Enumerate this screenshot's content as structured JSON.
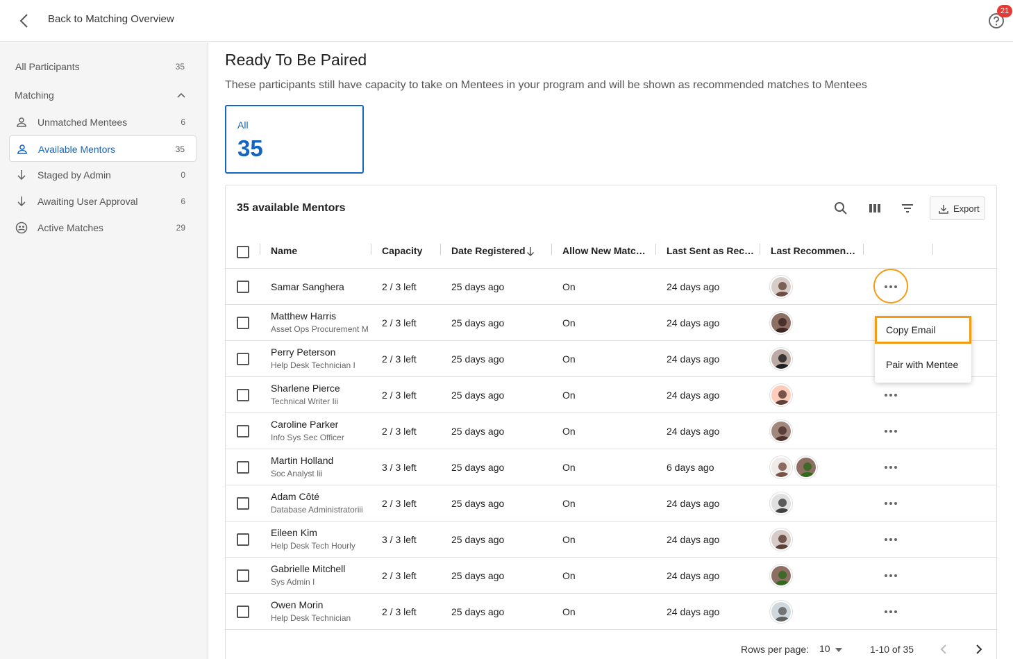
{
  "topbar": {
    "back_label": "Back to Matching Overview",
    "help_badge": "21"
  },
  "sidebar": {
    "all_participants": {
      "label": "All Participants",
      "count": "35"
    },
    "section_label": "Matching",
    "items": [
      {
        "label": "Unmatched Mentees",
        "count": "6",
        "icon": "person-icon"
      },
      {
        "label": "Available Mentors",
        "count": "35",
        "icon": "person-icon",
        "active": true
      },
      {
        "label": "Staged by Admin",
        "count": "0",
        "icon": "arrow-down-icon"
      },
      {
        "label": "Awaiting User Approval",
        "count": "6",
        "icon": "arrow-down-icon"
      },
      {
        "label": "Active Matches",
        "count": "29",
        "icon": "people-icon"
      }
    ]
  },
  "main": {
    "title": "Ready To Be Paired",
    "subtitle": "These participants still have capacity to take on Mentees in your program and will be shown as recommended matches to Mentees",
    "stat": {
      "label": "All",
      "value": "35"
    }
  },
  "table": {
    "title": "35 available Mentors",
    "export_label": "Export",
    "columns": [
      "Name",
      "Capacity",
      "Date Registered",
      "Allow New Matc…",
      "Last Sent as Rec…",
      "Last Recommen…"
    ],
    "rows": [
      {
        "name": "Samar Sanghera",
        "title": "",
        "capacity": "2 / 3 left",
        "registered": "25 days ago",
        "allow": "On",
        "last_sent": "24 days ago",
        "avatars": 1
      },
      {
        "name": "Matthew Harris",
        "title": "Asset Ops Procurement M",
        "capacity": "2 / 3 left",
        "registered": "25 days ago",
        "allow": "On",
        "last_sent": "24 days ago",
        "avatars": 1
      },
      {
        "name": "Perry Peterson",
        "title": "Help Desk Technician I",
        "capacity": "2 / 3 left",
        "registered": "25 days ago",
        "allow": "On",
        "last_sent": "24 days ago",
        "avatars": 1
      },
      {
        "name": "Sharlene Pierce",
        "title": "Technical Writer Iii",
        "capacity": "2 / 3 left",
        "registered": "25 days ago",
        "allow": "On",
        "last_sent": "24 days ago",
        "avatars": 1
      },
      {
        "name": "Caroline Parker",
        "title": "Info Sys Sec Officer",
        "capacity": "2 / 3 left",
        "registered": "25 days ago",
        "allow": "On",
        "last_sent": "24 days ago",
        "avatars": 1
      },
      {
        "name": "Martin Holland",
        "title": "Soc Analyst Iii",
        "capacity": "3 / 3 left",
        "registered": "25 days ago",
        "allow": "On",
        "last_sent": "6 days ago",
        "avatars": 2
      },
      {
        "name": "Adam Côté",
        "title": "Database Administratoriii",
        "capacity": "2 / 3 left",
        "registered": "25 days ago",
        "allow": "On",
        "last_sent": "24 days ago",
        "avatars": 1
      },
      {
        "name": "Eileen Kim",
        "title": "Help Desk Tech Hourly",
        "capacity": "3 / 3 left",
        "registered": "25 days ago",
        "allow": "On",
        "last_sent": "24 days ago",
        "avatars": 1
      },
      {
        "name": "Gabrielle Mitchell",
        "title": "Sys Admin I",
        "capacity": "2 / 3 left",
        "registered": "25 days ago",
        "allow": "On",
        "last_sent": "24 days ago",
        "avatars": 1
      },
      {
        "name": "Owen Morin",
        "title": "Help Desk Technician",
        "capacity": "2 / 3 left",
        "registered": "25 days ago",
        "allow": "On",
        "last_sent": "24 days ago",
        "avatars": 1
      }
    ],
    "menu": {
      "copy_email": "Copy Email",
      "pair": "Pair with Mentee"
    },
    "footer": {
      "rows_per_page_label": "Rows per page:",
      "rows_per_page": "10",
      "range": "1-10 of 35"
    }
  },
  "colors": {
    "accent": "#1565c0",
    "highlight": "#f39c12",
    "badge": "#e53935"
  }
}
